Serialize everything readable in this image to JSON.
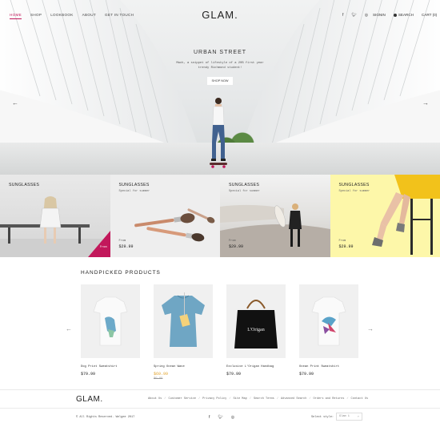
{
  "nav": {
    "left": [
      {
        "label": "HOME",
        "active": true
      },
      {
        "label": "SHOP",
        "active": false
      },
      {
        "label": "LOOKBOOK",
        "active": false
      },
      {
        "label": "ABOUT",
        "active": false
      },
      {
        "label": "GET IN TOUCH",
        "active": false
      }
    ],
    "logo": "GLAM.",
    "social": [
      "f",
      "𝕥",
      "◎"
    ],
    "signin": "SIGNIN",
    "search": "SEARCH",
    "cart": "CART (0)"
  },
  "hero": {
    "title": "URBAN STREET",
    "subtitle_line1": "Mach, a snippet of lifestyle of a 20B first year",
    "subtitle_line2": "trendy Richmond student!",
    "button": "SHOP NOW",
    "prev_arrow": "←",
    "next_arrow": "→"
  },
  "banners": [
    {
      "title": "SUNGLASSES",
      "subtitle": "",
      "price_label": "",
      "price": "",
      "tag": "From"
    },
    {
      "title": "SUNGLASSES",
      "subtitle": "Special for summer",
      "price_label": "From",
      "price": "$29.99"
    },
    {
      "title": "SUNGLASSES",
      "subtitle": "Special for summer",
      "price_label": "From",
      "price": "$29.99"
    },
    {
      "title": "SUNGLASSES",
      "subtitle": "Special for summer",
      "price_label": "From",
      "price": "$29.99"
    }
  ],
  "products_section": {
    "title": "HANDPICKED PRODUCTS",
    "prev_arrow": "←",
    "next_arrow": "→",
    "items": [
      {
        "name": "Dog Print Sweatshirt",
        "price": "$79.99",
        "old_price": ""
      },
      {
        "name": "Spring Ocean Wave",
        "price": "$69.99",
        "old_price": "$9.99"
      },
      {
        "name": "Exclusive L'Origan Handbag",
        "price": "$79.99",
        "old_price": ""
      },
      {
        "name": "Ocean Print Sweatshirt",
        "price": "$79.99",
        "old_price": ""
      }
    ]
  },
  "footer": {
    "logo": "GLAM.",
    "links": [
      "About Us",
      "Customer Service",
      "Privacy Policy",
      "Site Map",
      "Search Terms",
      "Advanced Search",
      "Orders and Returns",
      "Contact Us"
    ],
    "copyright": "© All Rights Reserved. Welgee 2017",
    "social": [
      "f",
      "𝕥",
      "◎"
    ],
    "style_label": "Select style:",
    "style_value": "Glam 1"
  },
  "colors": {
    "accent": "#c2185b",
    "sale": "#e2a32c",
    "banner4": "#fdf7a9"
  }
}
